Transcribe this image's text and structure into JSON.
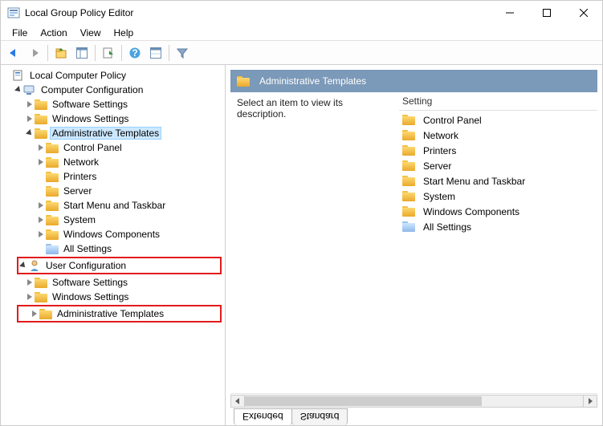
{
  "window": {
    "title": "Local Group Policy Editor"
  },
  "menu": {
    "file": "File",
    "action": "Action",
    "view": "View",
    "help": "Help"
  },
  "tree": {
    "root": "Local Computer Policy",
    "comp_config": "Computer Configuration",
    "cc_soft": "Software Settings",
    "cc_win": "Windows Settings",
    "cc_admin": "Administrative Templates",
    "cc_admin_cp": "Control Panel",
    "cc_admin_net": "Network",
    "cc_admin_prn": "Printers",
    "cc_admin_srv": "Server",
    "cc_admin_smt": "Start Menu and Taskbar",
    "cc_admin_sys": "System",
    "cc_admin_wc": "Windows Components",
    "cc_admin_all": "All Settings",
    "user_config": "User Configuration",
    "uc_soft": "Software Settings",
    "uc_win": "Windows Settings",
    "uc_admin": "Administrative Templates"
  },
  "right": {
    "header": "Administrative Templates",
    "desc": "Select an item to view its description.",
    "col": "Setting",
    "items": {
      "cp": "Control Panel",
      "net": "Network",
      "prn": "Printers",
      "srv": "Server",
      "smt": "Start Menu and Taskbar",
      "sys": "System",
      "wc": "Windows Components",
      "all": "All Settings"
    }
  },
  "tabs": {
    "extended": "Extended",
    "standard": "Standard"
  }
}
